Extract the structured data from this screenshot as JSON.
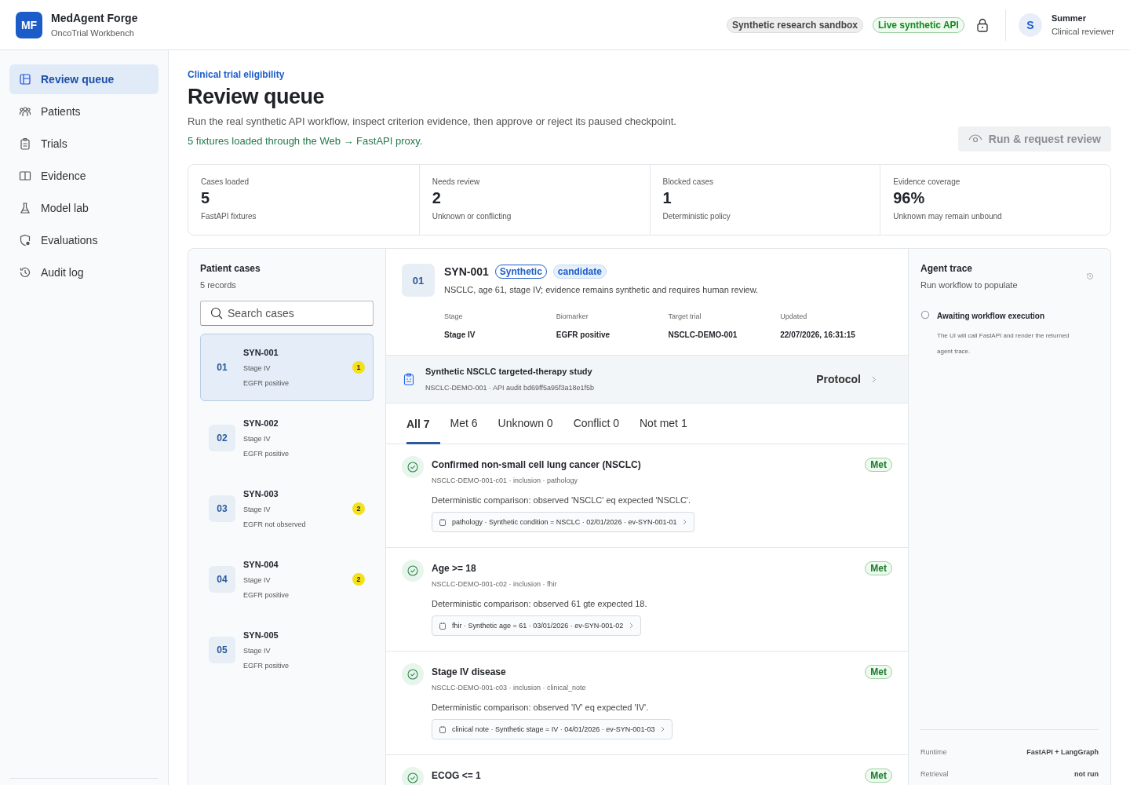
{
  "app": {
    "logo": "MF",
    "name": "MedAgent Forge",
    "subtitle": "OncoTrial Workbench"
  },
  "header": {
    "badges": [
      {
        "label": "Synthetic research sandbox",
        "kind": "neutral"
      },
      {
        "label": "Live synthetic API",
        "kind": "live"
      }
    ],
    "user": {
      "initial": "S",
      "name": "Summer",
      "role": "Clinical reviewer"
    }
  },
  "nav": [
    {
      "label": "Review queue",
      "kind": "queue",
      "selected": true
    },
    {
      "label": "Patients",
      "kind": "people",
      "selected": false
    },
    {
      "label": "Trials",
      "kind": "clipboard",
      "selected": false
    },
    {
      "label": "Evidence",
      "kind": "book",
      "selected": false
    },
    {
      "label": "Model lab",
      "kind": "flask",
      "selected": false
    },
    {
      "label": "Evaluations",
      "kind": "shield",
      "selected": false
    },
    {
      "label": "Audit log",
      "kind": "history",
      "selected": false
    }
  ],
  "page": {
    "eyebrow": "Clinical trial eligibility",
    "title": "Review queue",
    "description": "Run the real synthetic API workflow, inspect criterion evidence, then approve or reject its paused checkpoint.",
    "status": "5 fixtures loaded through the Web → FastAPI proxy.",
    "action": {
      "label": "Run & request review",
      "disabled": true
    }
  },
  "stats": [
    {
      "label": "Cases loaded",
      "value": "5",
      "note": "FastAPI fixtures"
    },
    {
      "label": "Needs review",
      "value": "2",
      "note": "Unknown or conflicting"
    },
    {
      "label": "Blocked cases",
      "value": "1",
      "note": "Deterministic policy"
    },
    {
      "label": "Evidence coverage",
      "value": "96%",
      "note": "Unknown may remain unbound"
    }
  ],
  "cases": {
    "title": "Patient cases",
    "count": "5 records",
    "search": {
      "placeholder": "Search cases"
    },
    "items": [
      {
        "num": "01",
        "id": "SYN-001",
        "stage": "Stage IV",
        "biomarker": "EGFR positive",
        "alerts": "1",
        "selected": true
      },
      {
        "num": "02",
        "id": "SYN-002",
        "stage": "Stage IV",
        "biomarker": "EGFR positive",
        "selected": false
      },
      {
        "num": "03",
        "id": "SYN-003",
        "stage": "Stage IV",
        "biomarker": "EGFR not observed",
        "alerts": "2",
        "selected": false
      },
      {
        "num": "04",
        "id": "SYN-004",
        "stage": "Stage IV",
        "biomarker": "EGFR positive",
        "alerts": "2",
        "selected": false
      },
      {
        "num": "05",
        "id": "SYN-005",
        "stage": "Stage IV",
        "biomarker": "EGFR positive",
        "selected": false
      }
    ]
  },
  "detail": {
    "num": "01",
    "id": "SYN-001",
    "tags": [
      {
        "label": "Synthetic",
        "kind": "outline"
      },
      {
        "label": "candidate",
        "kind": "soft"
      }
    ],
    "summary": "NSCLC, age 61, stage IV; evidence remains synthetic and requires human review.",
    "fields": [
      {
        "label": "Stage",
        "value": "Stage IV"
      },
      {
        "label": "Biomarker",
        "value": "EGFR positive"
      },
      {
        "label": "Target trial",
        "value": "NSCLC-DEMO-001"
      },
      {
        "label": "Updated",
        "value": "22/07/2026, 16:31:15"
      }
    ],
    "trial": {
      "title": "Synthetic NSCLC targeted-therapy study",
      "meta": "NSCLC-DEMO-001 · API audit bd69ff5a95f3a18e1f5b",
      "link": "Protocol"
    }
  },
  "tabs": [
    {
      "label": "All 7",
      "selected": true
    },
    {
      "label": "Met 6",
      "selected": false
    },
    {
      "label": "Unknown 0",
      "selected": false
    },
    {
      "label": "Conflict 0",
      "selected": false
    },
    {
      "label": "Not met 1",
      "selected": false
    }
  ],
  "criteria": [
    {
      "title": "Confirmed non-small cell lung cancer (NSCLC)",
      "meta": "NSCLC-DEMO-001-c01 · inclusion · pathology",
      "explanation": "Deterministic comparison: observed 'NSCLC' eq expected 'NSCLC'.",
      "evidence": "pathology · Synthetic condition = NSCLC · 02/01/2026 · ev-SYN-001-01",
      "status": "Met",
      "kind": "met"
    },
    {
      "title": "Age >= 18",
      "meta": "NSCLC-DEMO-001-c02 · inclusion · fhir",
      "explanation": "Deterministic comparison: observed 61 gte expected 18.",
      "evidence": "fhir · Synthetic age = 61 · 03/01/2026 · ev-SYN-001-02",
      "status": "Met",
      "kind": "met"
    },
    {
      "title": "Stage IV disease",
      "meta": "NSCLC-DEMO-001-c03 · inclusion · clinical_note",
      "explanation": "Deterministic comparison: observed 'IV' eq expected 'IV'.",
      "evidence": "clinical note · Synthetic stage = IV · 04/01/2026 · ev-SYN-001-03",
      "status": "Met",
      "kind": "met"
    },
    {
      "title": "ECOG <= 1",
      "status": "Met",
      "kind": "met"
    }
  ],
  "trace": {
    "title": "Agent trace",
    "subtitle": "Run workflow to populate",
    "steps": [
      {
        "title": "Awaiting workflow execution",
        "text": "The UI will call FastAPI and render the returned agent trace."
      }
    ],
    "footer": [
      {
        "label": "Runtime",
        "value": "FastAPI + LangGraph"
      },
      {
        "label": "Retrieval",
        "value": "not run"
      }
    ]
  }
}
